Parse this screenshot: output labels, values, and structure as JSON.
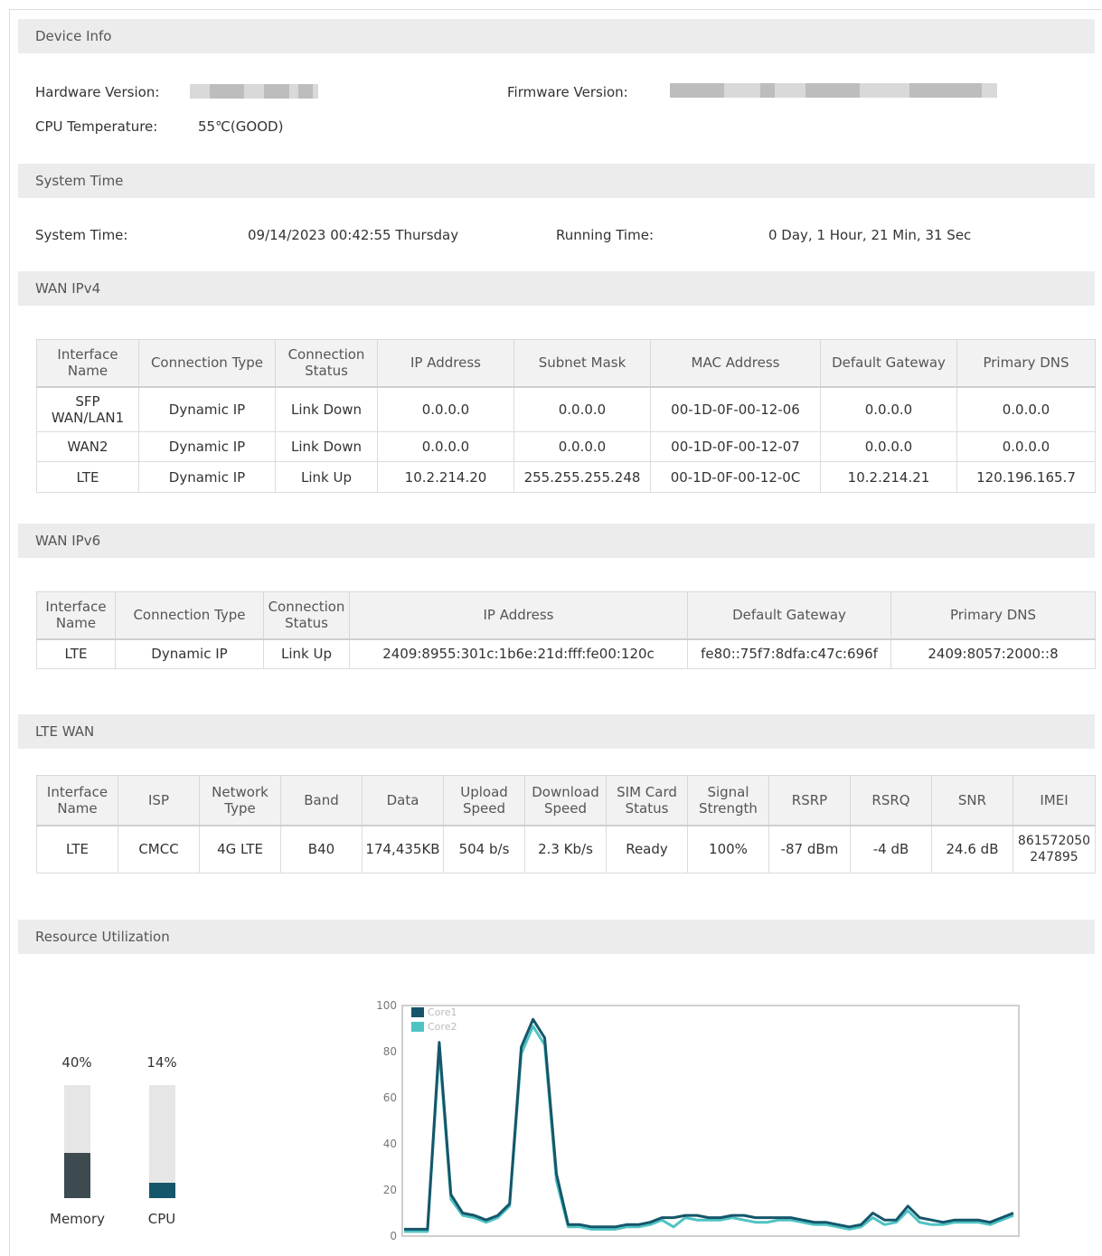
{
  "device_info": {
    "header": "Device Info",
    "hardware_label": "Hardware Version:",
    "firmware_label": "Firmware Version:",
    "cpu_temp_label": "CPU Temperature:",
    "cpu_temp_value": "55℃(GOOD)"
  },
  "system_time": {
    "header": "System Time",
    "time_label": "System Time:",
    "time_value": "09/14/2023 00:42:55 Thursday",
    "running_label": "Running Time:",
    "running_value": "0 Day, 1 Hour, 21 Min, 31 Sec"
  },
  "wan_ipv4": {
    "header": "WAN IPv4",
    "columns": [
      "Interface Name",
      "Connection Type",
      "Connection Status",
      "IP Address",
      "Subnet Mask",
      "MAC Address",
      "Default Gateway",
      "Primary DNS"
    ],
    "rows": [
      [
        "SFP WAN/LAN1",
        "Dynamic IP",
        "Link Down",
        "0.0.0.0",
        "0.0.0.0",
        "00-1D-0F-00-12-06",
        "0.0.0.0",
        "0.0.0.0"
      ],
      [
        "WAN2",
        "Dynamic IP",
        "Link Down",
        "0.0.0.0",
        "0.0.0.0",
        "00-1D-0F-00-12-07",
        "0.0.0.0",
        "0.0.0.0"
      ],
      [
        "LTE",
        "Dynamic IP",
        "Link Up",
        "10.2.214.20",
        "255.255.255.248",
        "00-1D-0F-00-12-0C",
        "10.2.214.21",
        "120.196.165.7"
      ]
    ]
  },
  "wan_ipv6": {
    "header": "WAN IPv6",
    "columns": [
      "Interface Name",
      "Connection Type",
      "Connection Status",
      "IP Address",
      "Default Gateway",
      "Primary DNS"
    ],
    "rows": [
      [
        "LTE",
        "Dynamic IP",
        "Link Up",
        "2409:8955:301c:1b6e:21d:fff:fe00:120c",
        "fe80::75f7:8dfa:c47c:696f",
        "2409:8057:2000::8"
      ]
    ]
  },
  "lte_wan": {
    "header": "LTE WAN",
    "columns": [
      "Interface Name",
      "ISP",
      "Network Type",
      "Band",
      "Data",
      "Upload Speed",
      "Download Speed",
      "SIM Card Status",
      "Signal Strength",
      "RSRP",
      "RSRQ",
      "SNR",
      "IMEI"
    ],
    "rows": [
      [
        "LTE",
        "CMCC",
        "4G LTE",
        "B40",
        "174,435KB",
        "504 b/s",
        "2.3 Kb/s",
        "Ready",
        "100%",
        "-87 dBm",
        "-4 dB",
        "24.6 dB",
        "861572050 247895"
      ]
    ]
  },
  "resource": {
    "header": "Resource Utilization",
    "memory": {
      "label": "Memory",
      "percent_text": "40%",
      "value": 40,
      "color": "#3d4a50"
    },
    "cpu": {
      "label": "CPU",
      "percent_text": "14%",
      "value": 14,
      "color": "#15566a"
    }
  },
  "chart_data": {
    "type": "line",
    "ylim": [
      0,
      100
    ],
    "yticks": [
      "100",
      "80",
      "60",
      "40",
      "20",
      "0"
    ],
    "series": [
      {
        "name": "Core1",
        "color": "#15566a",
        "values": [
          3,
          3,
          3,
          84,
          18,
          10,
          9,
          7,
          9,
          14,
          82,
          94,
          86,
          27,
          5,
          5,
          4,
          4,
          4,
          5,
          5,
          6,
          8,
          8,
          9,
          9,
          8,
          8,
          9,
          9,
          8,
          8,
          8,
          8,
          7,
          6,
          6,
          5,
          4,
          5,
          10,
          7,
          7,
          13,
          8,
          7,
          6,
          7,
          7,
          7,
          6,
          8,
          10
        ]
      },
      {
        "name": "Core2",
        "color": "#4fc3c3",
        "values": [
          2,
          2,
          2,
          81,
          16,
          9,
          8,
          6,
          8,
          13,
          79,
          91,
          83,
          24,
          4,
          4,
          3,
          3,
          3,
          4,
          4,
          5,
          7,
          4,
          8,
          7,
          7,
          7,
          8,
          7,
          6,
          6,
          7,
          7,
          6,
          5,
          5,
          4,
          3,
          4,
          8,
          5,
          6,
          11,
          6,
          5,
          5,
          6,
          6,
          6,
          5,
          7,
          9
        ]
      }
    ]
  }
}
